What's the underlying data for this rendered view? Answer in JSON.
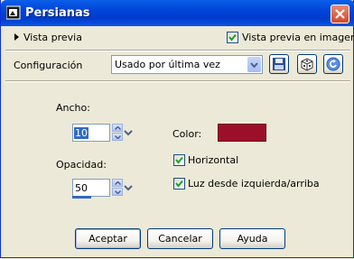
{
  "window": {
    "title": "Persianas",
    "close_icon": "close-x-icon"
  },
  "preview": {
    "toggle_label": "Vista previa",
    "in_image_label": "Vista previa en imagen",
    "in_image_checked": true
  },
  "config": {
    "label": "Configuración",
    "preset_value": "Usado por última vez",
    "icons": [
      "save-preset-icon",
      "random-dice-icon",
      "reset-icon"
    ]
  },
  "ancho": {
    "label": "Ancho:",
    "value": "10"
  },
  "opacidad": {
    "label": "Opacidad:",
    "value": "50",
    "level_percent": 50
  },
  "color": {
    "label": "Color:",
    "value": "#9b1028"
  },
  "horizontal": {
    "label": "Horizontal",
    "checked": true
  },
  "luz": {
    "label": "Luz desde izquierda/arriba",
    "checked": true
  },
  "buttons": {
    "ok": "Aceptar",
    "cancel": "Cancelar",
    "help": "Ayuda"
  }
}
